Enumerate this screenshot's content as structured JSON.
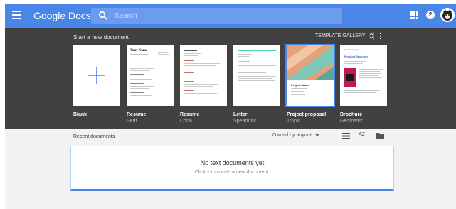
{
  "topbar": {
    "app_title": "Google Docs",
    "search_placeholder": "Search",
    "notification_count": "2",
    "accent_color": "#4a86e8"
  },
  "templates": {
    "heading": "Start a new document",
    "gallery_label": "TEMPLATE GALLERY",
    "items": [
      {
        "name": "Blank",
        "sub": ""
      },
      {
        "name": "Resume",
        "sub": "Serif"
      },
      {
        "name": "Resume",
        "sub": "Coral"
      },
      {
        "name": "Letter",
        "sub": "Spearmint"
      },
      {
        "name": "Project proposal",
        "sub": "Tropic"
      },
      {
        "name": "Brochure",
        "sub": "Geometric"
      }
    ],
    "thumb_text": {
      "resume_serif_name": "Your Name",
      "proposal_title": "Project Name",
      "brochure_company": "Your Company",
      "brochure_title": "Product Brochure"
    }
  },
  "recent": {
    "heading": "Recent documents",
    "owner_filter": "Owned by anyone",
    "sort_label": "AZ",
    "empty_title": "No text documents yet",
    "empty_sub": "Click + to create a new document."
  }
}
